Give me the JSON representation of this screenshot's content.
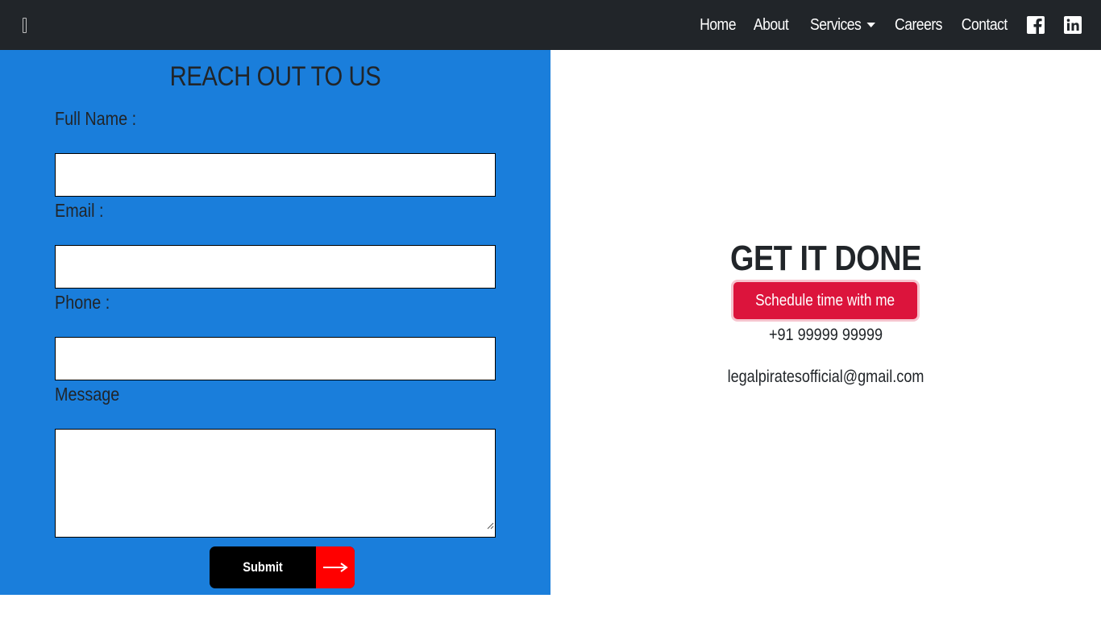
{
  "nav": {
    "items": [
      {
        "label": "Home"
      },
      {
        "label": "About"
      },
      {
        "label": "Services"
      },
      {
        "label": "Careers"
      },
      {
        "label": "Contact"
      }
    ],
    "social": [
      "facebook-icon",
      "linkedin-icon"
    ]
  },
  "form": {
    "title": "REACH OUT TO US",
    "fullname_label": "Full Name :",
    "email_label": "Email :",
    "phone_label": "Phone :",
    "message_label": "Message",
    "fullname_value": "",
    "email_value": "",
    "phone_value": "",
    "message_value": "",
    "submit_label": "Submit",
    "submit_arrow": "⟶"
  },
  "cta": {
    "title": "GET IT DONE",
    "schedule_label": "Schedule time with me",
    "phone": "+91 99999 99999",
    "email": "legalpiratesofficial@gmail.com"
  },
  "colors": {
    "navbar": "#212529",
    "panel": "#1a7edb",
    "schedule_button": "#dc143c",
    "submit_arrow_bg": "#ff0000"
  }
}
